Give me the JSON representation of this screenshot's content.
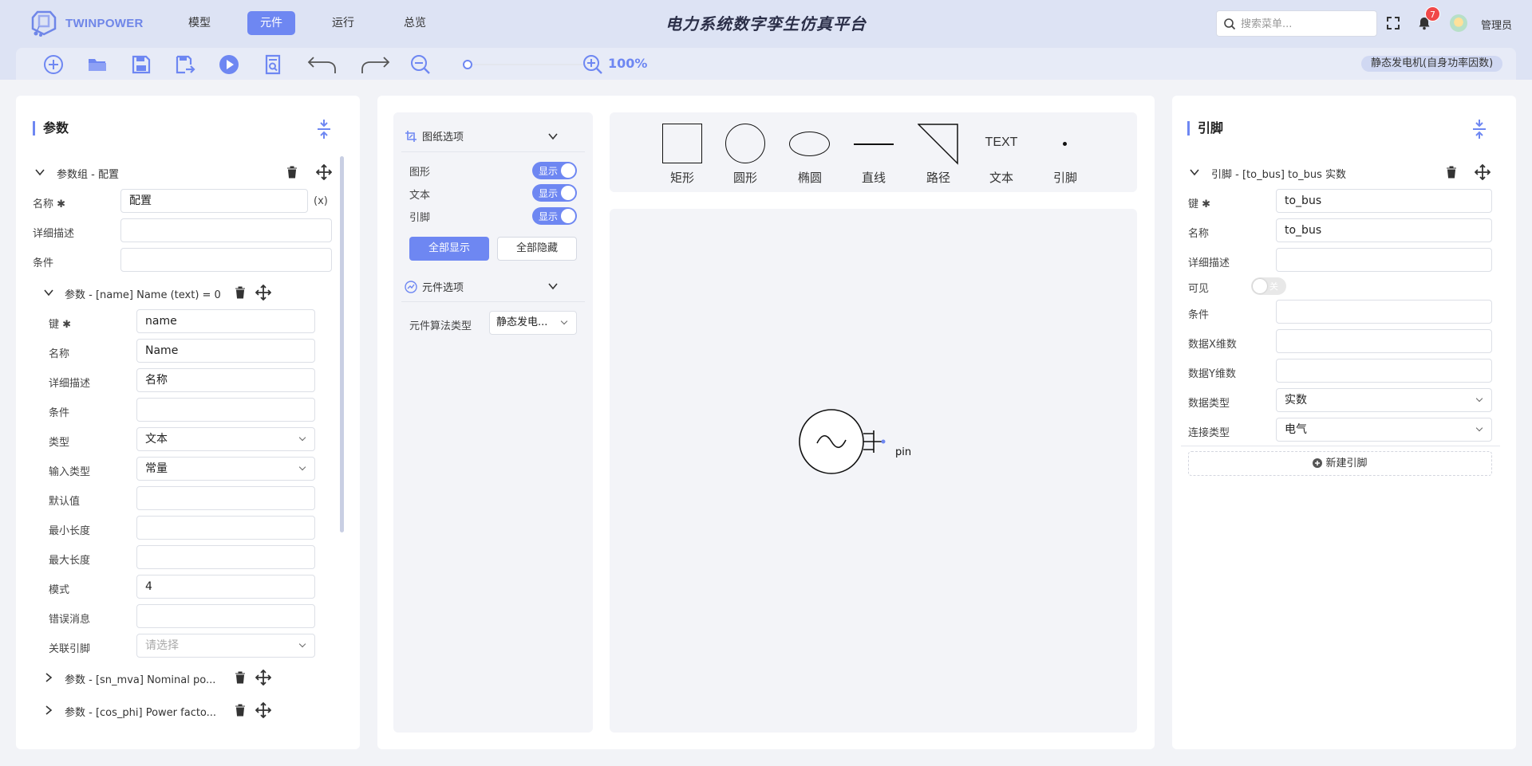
{
  "brand": {
    "name": "TWINPOWER"
  },
  "nav": {
    "model": "模型",
    "component": "元件",
    "run": "运行",
    "overview": "总览"
  },
  "platform_title": "电力系统数字孪生仿真平台",
  "search": {
    "placeholder": "搜索菜单..."
  },
  "notifications": {
    "count": "7"
  },
  "user": {
    "name": "管理员"
  },
  "toolbar": {
    "zoom": "100%",
    "component_tag": "静态发电机(自身功率因数)"
  },
  "colors": {
    "accent": "#6e87f2",
    "header_bg": "#dde3f4",
    "badge": "#f04848"
  },
  "params": {
    "title": "参数",
    "group_title": "参数组 - 配置",
    "group_fields": {
      "name_label": "名称 ✱",
      "name_value": "配置",
      "var_button": "(x)",
      "desc_label": "详细描述",
      "desc_value": "",
      "cond_label": "条件",
      "cond_value": ""
    },
    "param_title": "参数 - [name] Name (text) = 0",
    "fields": {
      "key_label": "键 ✱",
      "key_value": "name",
      "name_label": "名称",
      "name_value": "Name",
      "desc_label": "详细描述",
      "desc_value": "名称",
      "cond_label": "条件",
      "cond_value": "",
      "type_label": "类型",
      "type_value": "文本",
      "input_type_label": "输入类型",
      "input_type_value": "常量",
      "default_label": "默认值",
      "default_value": "",
      "minlen_label": "最小长度",
      "minlen_value": "",
      "maxlen_label": "最大长度",
      "maxlen_value": "",
      "pattern_label": "模式",
      "pattern_value": "4",
      "error_label": "错误消息",
      "error_value": "",
      "linked_pin_label": "关联引脚",
      "linked_pin_placeholder": "请选择"
    },
    "collapsed": [
      "参数 - [sn_mva] Nominal po...",
      "参数 - [cos_phi] Power facto..."
    ]
  },
  "drawing_options": {
    "title": "图纸选项",
    "rows": [
      {
        "label": "图形",
        "toggle": "显示"
      },
      {
        "label": "文本",
        "toggle": "显示"
      },
      {
        "label": "引脚",
        "toggle": "显示"
      }
    ],
    "show_all": "全部显示",
    "hide_all": "全部隐藏"
  },
  "component_options": {
    "title": "元件选项",
    "algo_label": "元件算法类型",
    "algo_value": "静态发电..."
  },
  "shapes": [
    {
      "name": "矩形"
    },
    {
      "name": "圆形"
    },
    {
      "name": "椭圆"
    },
    {
      "name": "直线"
    },
    {
      "name": "路径"
    },
    {
      "name": "文本",
      "glyph": "TEXT"
    },
    {
      "name": "引脚"
    }
  ],
  "canvas": {
    "pin_label": "pin"
  },
  "pins": {
    "title": "引脚",
    "pin_title": "引脚 - [to_bus] to_bus 实数",
    "fields": {
      "key_label": "键 ✱",
      "key_value": "to_bus",
      "name_label": "名称",
      "name_value": "to_bus",
      "desc_label": "详细描述",
      "desc_value": "",
      "visible_label": "可见",
      "visible_toggle": "关",
      "cond_label": "条件",
      "cond_value": "",
      "xdim_label": "数据X维数",
      "xdim_value": "",
      "ydim_label": "数据Y维数",
      "ydim_value": "",
      "dtype_label": "数据类型",
      "dtype_value": "实数",
      "conn_label": "连接类型",
      "conn_value": "电气"
    },
    "new_pin": "新建引脚"
  }
}
